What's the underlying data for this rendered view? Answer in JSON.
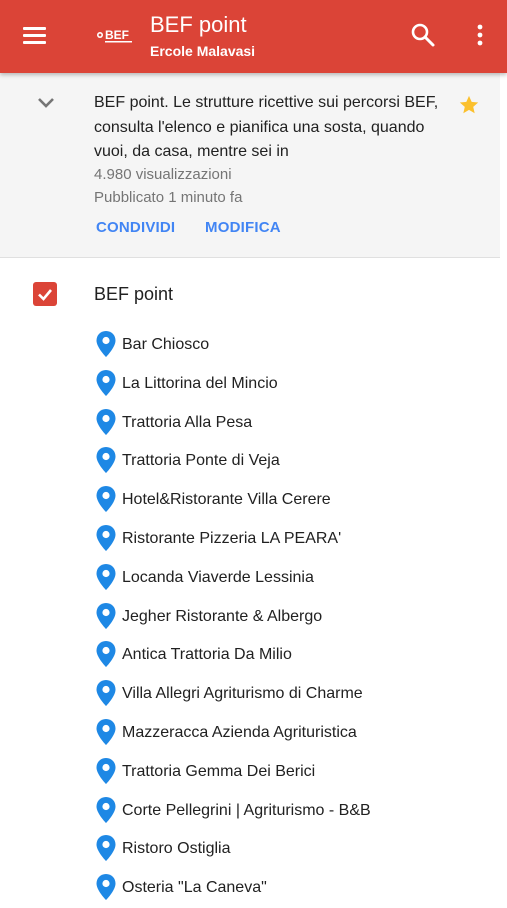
{
  "app_bar": {
    "title": "BEF point",
    "subtitle": "Ercole Malavasi",
    "logo_text": "BEF",
    "color": "#db4437",
    "icons": [
      "menu-icon",
      "search-icon",
      "more-vert-icon"
    ]
  },
  "map_info": {
    "description": "BEF point. Le strutture ricettive sui percorsi BEF, consulta l'elenco e pianifica una sosta, quando vuoi, da casa, mentre sei in",
    "views": "4.980 visualizzazioni",
    "published": "Pubblicato 1 minuto fa",
    "share_label": "CONDIVIDI",
    "edit_label": "MODIFICA",
    "star_color": "#fbc02d",
    "accent_color": "#4285f4"
  },
  "layer": {
    "title": "BEF point",
    "checked": true,
    "pin_color": "#1e88e5",
    "places": [
      "Bar Chiosco",
      "La Littorina del Mincio",
      "Trattoria Alla Pesa",
      "Trattoria Ponte di Veja",
      "Hotel&Ristorante Villa Cerere",
      "Ristorante Pizzeria LA PEARA'",
      "Locanda Viaverde Lessinia",
      "Jegher Ristorante & Albergo",
      "Antica Trattoria Da Milio",
      "Villa Allegri Agriturismo di Charme",
      "Mazzeracca Azienda Agrituristica",
      "Trattoria Gemma Dei Berici",
      "Corte Pellegrini | Agriturismo - B&B",
      "Ristoro Ostiglia",
      "Osteria \"La Caneva\""
    ]
  }
}
